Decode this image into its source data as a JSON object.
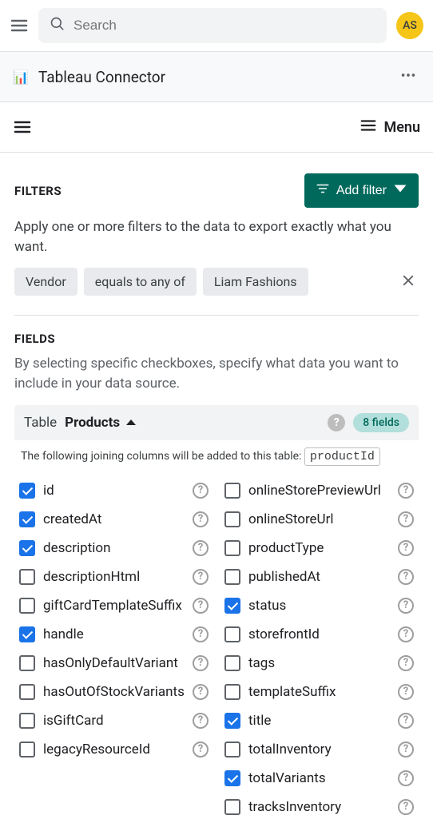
{
  "header": {
    "search_placeholder": "Search",
    "avatar_initials": "AS"
  },
  "app": {
    "title": "Tableau Connector",
    "icon": "📊"
  },
  "menu": {
    "label": "Menu"
  },
  "filters": {
    "title": "FILTERS",
    "add_label": "Add filter",
    "description": "Apply one or more filters to the data to export exactly what you want.",
    "chips": [
      "Vendor",
      "equals to any of",
      "Liam Fashions"
    ]
  },
  "fields": {
    "title": "FIELDS",
    "description": "By selecting specific checkboxes, specify what data you want to include in your data source.",
    "table_label": "Table",
    "table_name": "Products",
    "count_badge": "8 fields",
    "joining_note": "The following joining columns will be added to this table:",
    "joining_column": "productId",
    "left_col": [
      {
        "name": "id",
        "checked": true
      },
      {
        "name": "createdAt",
        "checked": true
      },
      {
        "name": "description",
        "checked": true
      },
      {
        "name": "descriptionHtml",
        "checked": false
      },
      {
        "name": "giftCardTemplateSuffix",
        "checked": false
      },
      {
        "name": "handle",
        "checked": true
      },
      {
        "name": "hasOnlyDefaultVariant",
        "checked": false
      },
      {
        "name": "hasOutOfStockVariants",
        "checked": false
      },
      {
        "name": "isGiftCard",
        "checked": false
      },
      {
        "name": "legacyResourceId",
        "checked": false
      }
    ],
    "right_col": [
      {
        "name": "onlineStorePreviewUrl",
        "checked": false
      },
      {
        "name": "onlineStoreUrl",
        "checked": false
      },
      {
        "name": "productType",
        "checked": false
      },
      {
        "name": "publishedAt",
        "checked": false
      },
      {
        "name": "status",
        "checked": true
      },
      {
        "name": "storefrontId",
        "checked": false
      },
      {
        "name": "tags",
        "checked": false
      },
      {
        "name": "templateSuffix",
        "checked": false
      },
      {
        "name": "title",
        "checked": true
      },
      {
        "name": "totalInventory",
        "checked": false
      },
      {
        "name": "totalVariants",
        "checked": true
      },
      {
        "name": "tracksInventory",
        "checked": false
      }
    ]
  }
}
